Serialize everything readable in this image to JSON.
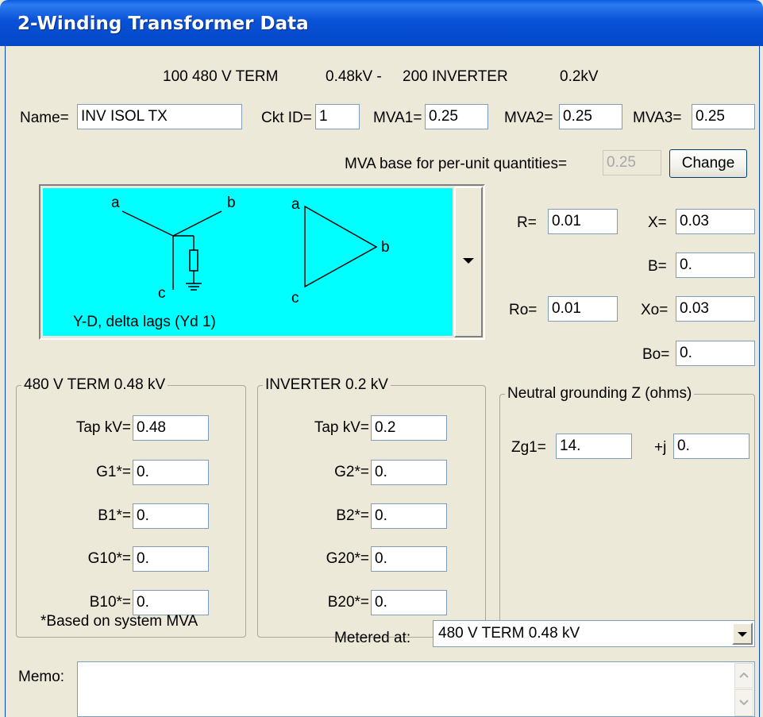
{
  "window": {
    "title": "2-Winding Transformer Data"
  },
  "header": {
    "from_bus": "100 480 V TERM",
    "from_kv": "0.48kV -",
    "to_bus": "200 INVERTER",
    "to_kv": "0.2kV"
  },
  "fields": {
    "name_label": "Name=",
    "name_value": "INV ISOL TX",
    "ckt_label": "Ckt ID=",
    "ckt_value": "1",
    "mva1_label": "MVA1=",
    "mva1_value": "0.25",
    "mva2_label": "MVA2=",
    "mva2_value": "0.25",
    "mva3_label": "MVA3=",
    "mva3_value": "0.25"
  },
  "mva_base": {
    "label": "MVA base for per-unit quantities=",
    "value": "0.25",
    "change_button": "Change"
  },
  "diagram": {
    "caption": "Y-D, delta lags (Yd 1)",
    "wye_labels": {
      "a": "a",
      "b": "b",
      "c": "c"
    },
    "delta_labels": {
      "a": "a",
      "b": "b",
      "c": "c"
    }
  },
  "impedance": {
    "r_label": "R=",
    "r_value": "0.01",
    "x_label": "X=",
    "x_value": "0.03",
    "b_label": "B=",
    "b_value": "0.",
    "ro_label": "Ro=",
    "ro_value": "0.01",
    "xo_label": "Xo=",
    "xo_value": "0.03",
    "bo_label": "Bo=",
    "bo_value": "0."
  },
  "winding1": {
    "title": "480 V TERM   0.48 kV",
    "tap_label": "Tap kV=",
    "tap_value": "0.48",
    "g_label": "G1*=",
    "g_value": "0.",
    "b_label": "B1*=",
    "b_value": "0.",
    "g0_label": "G10*=",
    "g0_value": "0.",
    "b0_label": "B10*=",
    "b0_value": "0."
  },
  "winding2": {
    "title": "INVERTER    0.2  kV",
    "tap_label": "Tap kV=",
    "tap_value": "0.2",
    "g_label": "G2*=",
    "g_value": "0.",
    "b_label": "B2*=",
    "b_value": "0.",
    "g0_label": "G20*=",
    "g0_value": "0.",
    "b0_label": "B20*=",
    "b0_value": "0."
  },
  "neutral": {
    "title": "Neutral grounding Z (ohms)",
    "zg_label": "Zg1=",
    "zg_real": "14.",
    "j_label": "+j",
    "zg_imag": "0."
  },
  "footer": {
    "note": "*Based on system MVA",
    "metered_label": "Metered at:",
    "metered_value": "480 V TERM   0.48 kV",
    "memo_label": "Memo:",
    "memo_value": ""
  }
}
